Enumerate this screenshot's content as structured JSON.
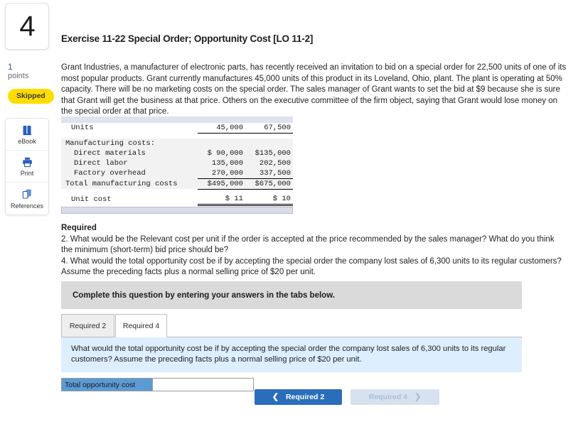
{
  "question": {
    "number": "4",
    "points_value": "1",
    "points_label": "points",
    "status_badge": "Skipped"
  },
  "tools": [
    {
      "label": "eBook",
      "icon": "book-icon"
    },
    {
      "label": "Print",
      "icon": "printer-icon"
    },
    {
      "label": "References",
      "icon": "copy-pages-icon"
    }
  ],
  "exercise": {
    "title": "Exercise 11-22 Special Order; Opportunity Cost [LO 11-2]",
    "body": "Grant Industries, a manufacturer of electronic parts, has recently received an invitation to bid on a special order for 22,500 units of one of its most popular products. Grant currently manufactures 45,000 units of this product in its Loveland, Ohio, plant. The plant is operating at 50% capacity. There will be no marketing costs on the special order. The sales manager of Grant wants to set the bid at $9 because she is sure that Grant will get the business at that price. Others on the executive committee of the firm object, saying that Grant would lose money on the special order at that price."
  },
  "exhibit": {
    "rows": [
      {
        "label": "Units",
        "indent": 1,
        "col1": "45,000",
        "col2": "67,500",
        "underline": "single",
        "alt": false
      },
      {
        "label": "Manufacturing costs:",
        "indent": 0,
        "col1": "",
        "col2": "",
        "underline": "none",
        "alt": true
      },
      {
        "label": "Direct materials",
        "indent": 2,
        "col1": "$ 90,000",
        "col2": "$135,000",
        "underline": "none",
        "alt": true
      },
      {
        "label": "Direct labor",
        "indent": 2,
        "col1": "135,000",
        "col2": "202,500",
        "underline": "none",
        "alt": true
      },
      {
        "label": "Factory overhead",
        "indent": 2,
        "col1": "270,000",
        "col2": "337,500",
        "underline": "single",
        "alt": true
      },
      {
        "label": "Total manufacturing costs",
        "indent": 0,
        "col1": "$495,000",
        "col2": "$675,000",
        "underline": "none",
        "alt": true
      },
      {
        "label": "Unit cost",
        "indent": 1,
        "col1": "$      11",
        "col2": "$      10",
        "underline": "double",
        "alt": false
      }
    ]
  },
  "required": {
    "heading": "Required",
    "item2": "2. What would be the Relevant cost per unit if the order is accepted at the price recommended by the sales manager? What do you think the minimum (short-term) bid price should be?",
    "item4": "4. What would the total opportunity cost be if by accepting the special order the company lost sales of 6,300 units to its regular customers? Assume the preceding facts plus a normal selling price of $20 per unit."
  },
  "panel": {
    "banner": "Complete this question by entering your answers in the tabs below.",
    "tabs": [
      {
        "label": "Required 2",
        "active": false
      },
      {
        "label": "Required 4",
        "active": true
      }
    ],
    "tab_question": "What would the total opportunity cost be if by accepting the special order the company lost sales of 6,300 units to its regular customers? Assume the preceding facts plus a normal selling price of $20 per unit.",
    "answer_label": "Total opportunity cost",
    "answer_value": "",
    "answer_placeholder": ""
  },
  "nav": {
    "prev_label": "Required 2",
    "prev_icon": "chevron-left-icon",
    "next_label": "Required 4",
    "next_icon": "chevron-right-icon"
  },
  "colors": {
    "primary_blue": "#2a6ebb",
    "disabled_blue": "#d6e2f0",
    "badge_yellow": "#ffdd00",
    "question_blue": "#ddeeff",
    "banner_gray": "#dadada",
    "answer_label_blue": "#5b9bd5",
    "exhibit_bar": "#dfe3ee"
  }
}
